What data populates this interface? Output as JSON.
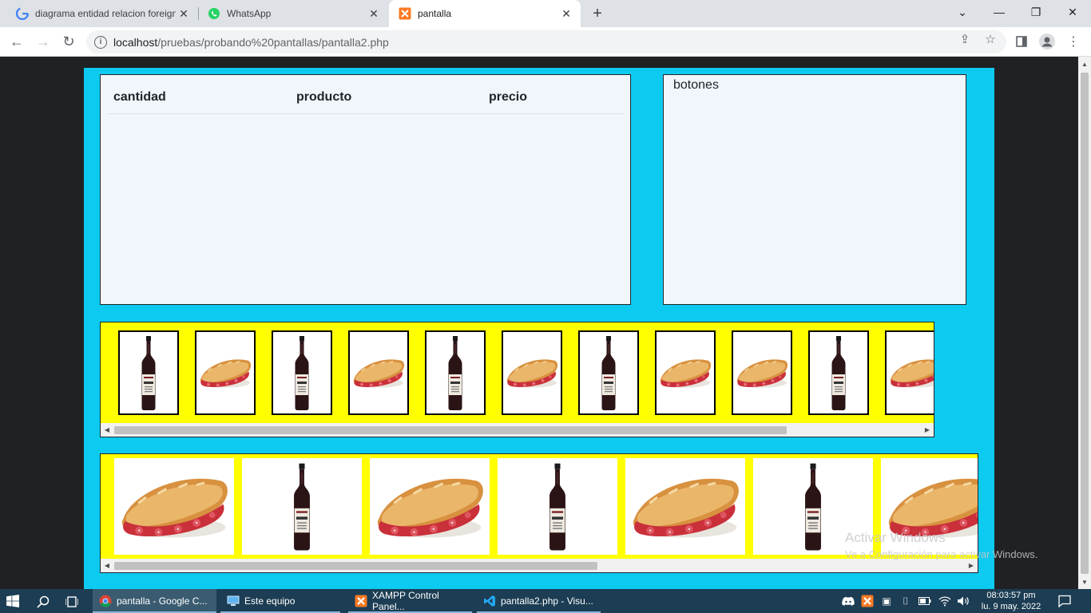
{
  "browser": {
    "tabs": [
      {
        "title": "diagrama entidad relacion foreign",
        "icon": "google-icon"
      },
      {
        "title": "WhatsApp",
        "icon": "whatsapp-icon"
      },
      {
        "title": "pantalla",
        "icon": "xampp-icon"
      }
    ],
    "address": {
      "host": "localhost",
      "path": "/pruebas/probando%20pantallas/pantalla2.php"
    }
  },
  "page": {
    "table_headers": [
      "cantidad",
      "producto",
      "precio"
    ],
    "buttons_label": "botones",
    "strip1_items": [
      "wine",
      "sandwich",
      "wine",
      "sandwich",
      "wine",
      "sandwich",
      "wine",
      "sandwich",
      "sandwich",
      "wine",
      "sandwich"
    ],
    "strip2_items": [
      "sandwich",
      "wine",
      "sandwich",
      "wine",
      "sandwich",
      "wine",
      "sandwich"
    ],
    "colors": {
      "background": "#0dcaf0",
      "strip": "#ffff00",
      "panel": "#f0f6fc"
    }
  },
  "watermark": {
    "title": "Activar Windows",
    "subtitle": "Ve a Configuración para activar Windows."
  },
  "taskbar": {
    "apps": [
      {
        "label": "pantalla - Google C...",
        "icon": "chrome-icon"
      },
      {
        "label": "Este equipo",
        "icon": "computer-icon"
      },
      {
        "label": "XAMPP Control Panel...",
        "icon": "xampp-icon"
      },
      {
        "label": "pantalla2.php - Visu...",
        "icon": "vscode-icon"
      }
    ],
    "time": "08:03:57 pm",
    "date": "lu. 9 may. 2022"
  }
}
